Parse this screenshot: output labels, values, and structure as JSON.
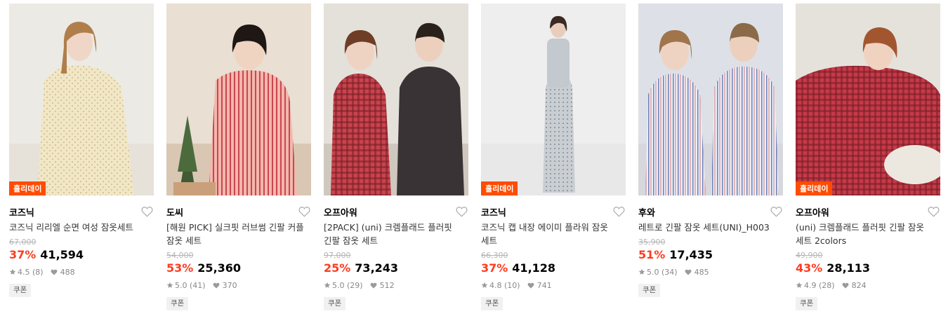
{
  "products": [
    {
      "badge": "홀리데이",
      "brand": "코즈닉",
      "title": "코즈닉 리리엘 순면 여성 잠옷세트",
      "original_price": "67,000",
      "discount": "37%",
      "price": "41,594",
      "rating": "4.5",
      "reviews": "(8)",
      "likes": "488",
      "coupon": "쿠폰",
      "image": {
        "bg": "#eceae4",
        "floor": "#e6e2da",
        "outfit": "#f1e7c6",
        "hair": "#b07e4b",
        "pattern": "floral"
      }
    },
    {
      "badge": "",
      "brand": "도씨",
      "title": "[해원 PICK] 실크핏 러브썸 긴팔 커플 잠옷 세트",
      "original_price": "54,000",
      "discount": "53%",
      "price": "25,360",
      "rating": "5.0",
      "reviews": "(41)",
      "likes": "370",
      "coupon": "쿠폰",
      "image": {
        "bg": "#e9dfd3",
        "floor": "#d9c7b4",
        "outfit": "#f3b7ad",
        "hair": "#1e1714",
        "pattern": "stripe-red"
      }
    },
    {
      "badge": "",
      "brand": "오프아워",
      "title": "[2PACK] (uni) 크렘플래드 플러핏 긴팔 잠옷 세트",
      "original_price": "97,000",
      "discount": "25%",
      "price": "73,243",
      "rating": "5.0",
      "reviews": "(29)",
      "likes": "512",
      "coupon": "쿠폰",
      "image": {
        "bg": "#e4e0da",
        "floor": "#cfc8be",
        "outfit": "#c9444d",
        "hair": "#6e3d25",
        "pattern": "check"
      }
    },
    {
      "badge": "홀리데이",
      "brand": "코즈닉",
      "title": "코즈닉 캡 내장 에이미 플라워 잠옷 세트",
      "original_price": "66,300",
      "discount": "37%",
      "price": "41,128",
      "rating": "4.8",
      "reviews": "(10)",
      "likes": "741",
      "coupon": "쿠폰",
      "image": {
        "bg": "#eeeeee",
        "floor": "#e8e8e8",
        "outfit": "#c9ced3",
        "hair": "#3a2a22",
        "pattern": "dots"
      }
    },
    {
      "badge": "",
      "brand": "후와",
      "title": "레트로 긴팔 잠옷 세트(UNI)_H003",
      "original_price": "35,900",
      "discount": "51%",
      "price": "17,435",
      "rating": "5.0",
      "reviews": "(34)",
      "likes": "485",
      "coupon": "쿠폰",
      "image": {
        "bg": "#dde0e6",
        "floor": "#d6d8de",
        "outfit": "#eef0f7",
        "hair": "#a0754c",
        "pattern": "stripe-blue"
      }
    },
    {
      "badge": "홀리데이",
      "brand": "오프아워",
      "title": "(uni) 크렘플래드 플러핏 긴팔 잠옷 세트 2colors",
      "original_price": "49,900",
      "discount": "43%",
      "price": "28,113",
      "rating": "4.9",
      "reviews": "(28)",
      "likes": "824",
      "coupon": "쿠폰",
      "image": {
        "bg": "#e5e2dc",
        "floor": "#efeae2",
        "outfit": "#c63a48",
        "hair": "#a2562f",
        "pattern": "check"
      }
    }
  ]
}
